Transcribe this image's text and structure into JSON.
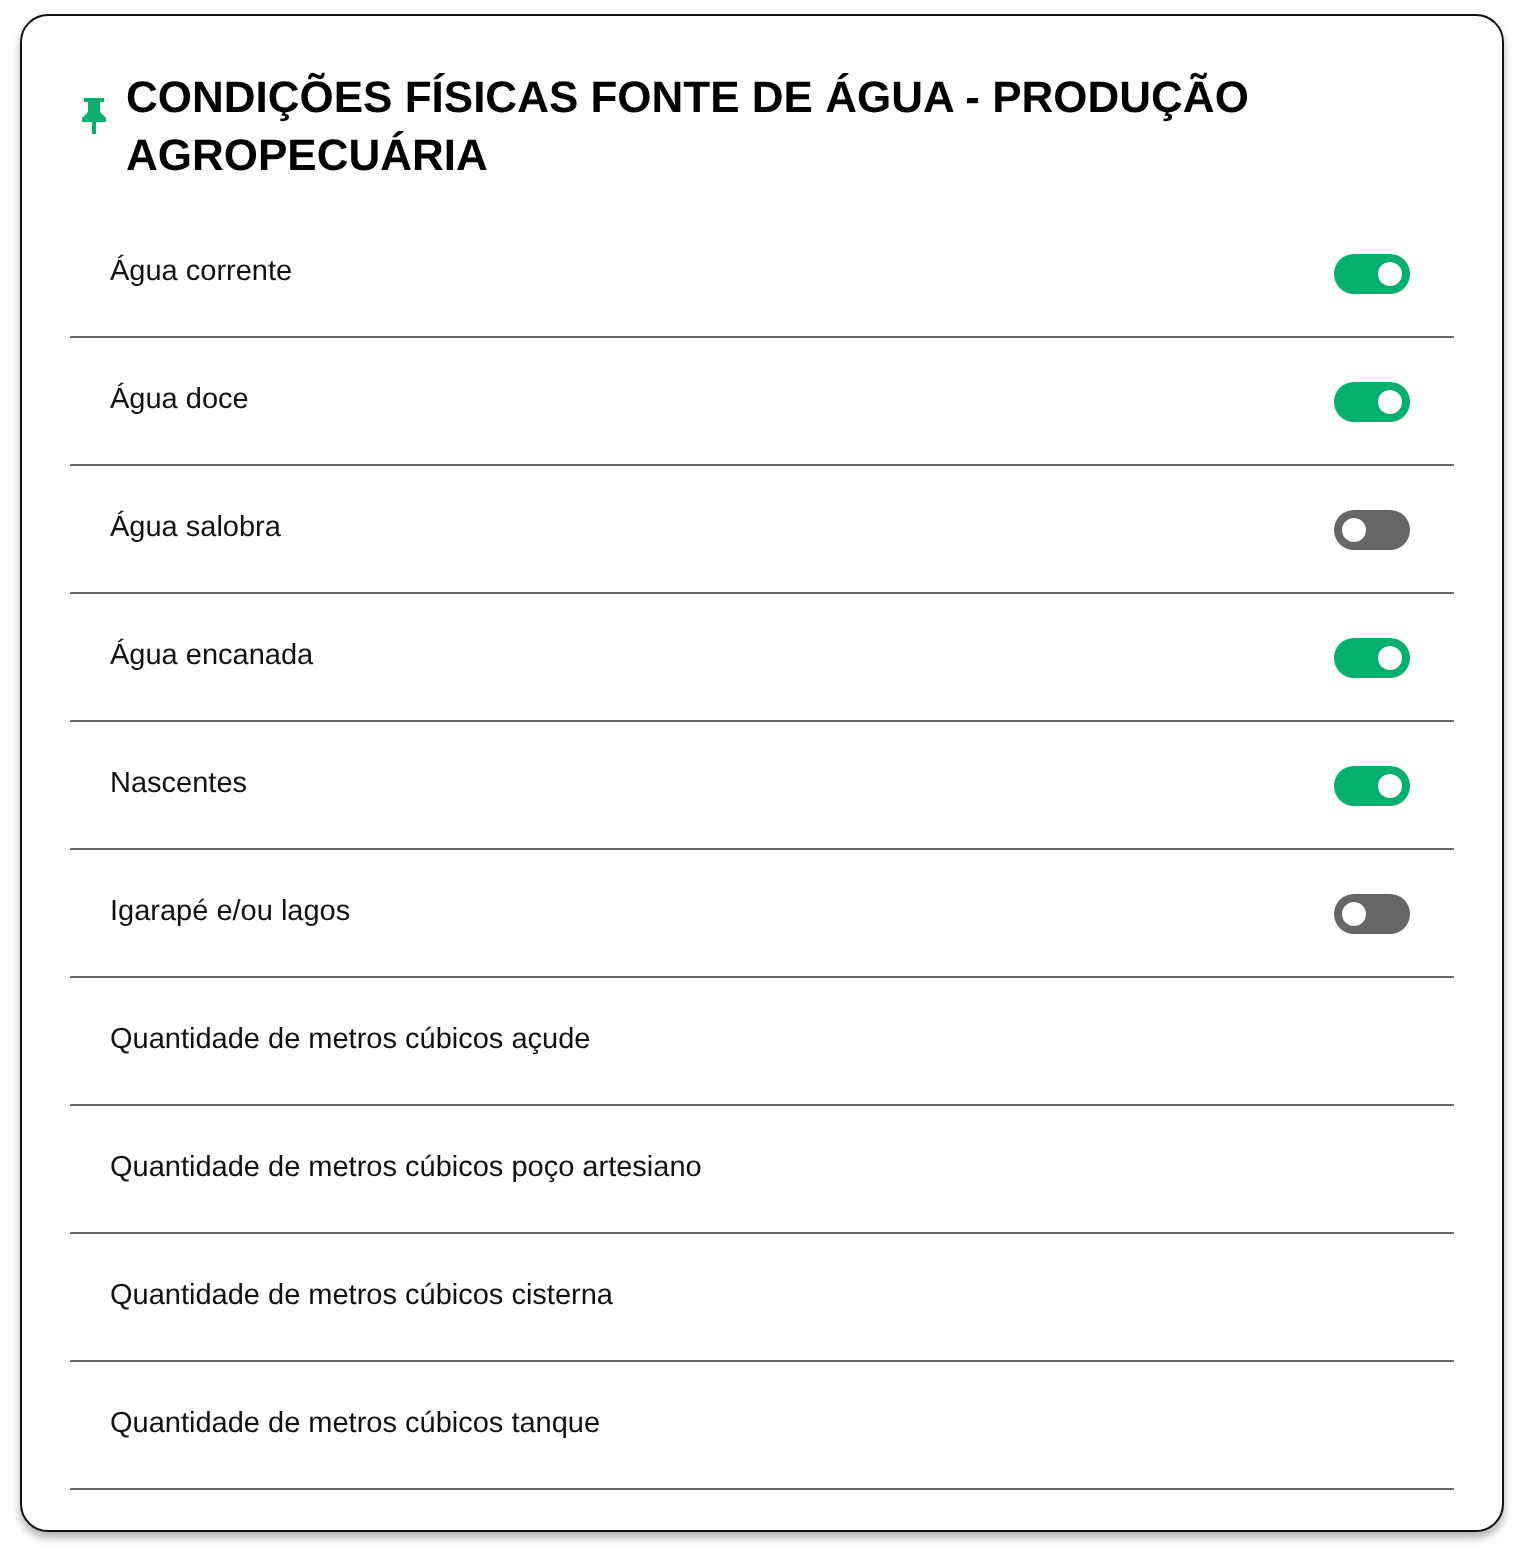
{
  "title": "CONDIÇÕES FÍSICAS FONTE DE ÁGUA - PRODUÇÃO AGROPECUÁRIA",
  "rows": [
    {
      "kind": "toggle",
      "label": "Água corrente",
      "on": true
    },
    {
      "kind": "toggle",
      "label": "Água doce",
      "on": true
    },
    {
      "kind": "toggle",
      "label": "Água salobra",
      "on": false
    },
    {
      "kind": "toggle",
      "label": "Água encanada",
      "on": true
    },
    {
      "kind": "toggle",
      "label": "Nascentes",
      "on": true
    },
    {
      "kind": "toggle",
      "label": "Igarapé e/ou lagos",
      "on": false
    },
    {
      "kind": "text",
      "label": "Quantidade de metros cúbicos açude"
    },
    {
      "kind": "text",
      "label": "Quantidade de metros cúbicos poço artesiano"
    },
    {
      "kind": "text",
      "label": "Quantidade de metros cúbicos cisterna"
    },
    {
      "kind": "text",
      "label": "Quantidade de metros cúbicos tanque"
    }
  ]
}
